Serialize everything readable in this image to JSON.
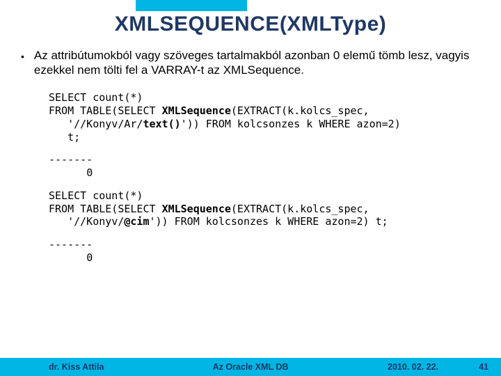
{
  "title": "XMLSEQUENCE(XMLType)",
  "bullet": "Az attribútumokból vagy szöveges tartalmakból azonban 0 elemű tömb lesz, vagyis ezekkel nem tölti fel a VARRAY-t az XMLSequence.",
  "code1": {
    "l1": "SELECT count(*)",
    "l2a": "FROM TABLE(SELECT ",
    "l2b": "XMLSequence",
    "l2c": "(EXTRACT(k.kolcs_spec,",
    "l3a": "   '//Konyv/Ar/",
    "l3b": "text()",
    "l3c": "')) FROM kolcsonzes k WHERE azon=2)",
    "l4": "   t;"
  },
  "out1": {
    "dash": "-------",
    "val": "      0"
  },
  "code2": {
    "l1": "SELECT count(*)",
    "l2a": "FROM TABLE(SELECT ",
    "l2b": "XMLSequence",
    "l2c": "(EXTRACT(k.kolcs_spec,",
    "l3a": "   '//Konyv/",
    "l3b": "@cim",
    "l3c": "')) FROM kolcsonzes k WHERE azon=2) t;"
  },
  "out2": {
    "dash": "-------",
    "val": "      0"
  },
  "footer": {
    "author": "dr. Kiss Attila",
    "center": "Az Oracle XML DB",
    "date": "2010. 02. 22.",
    "page": "41"
  }
}
